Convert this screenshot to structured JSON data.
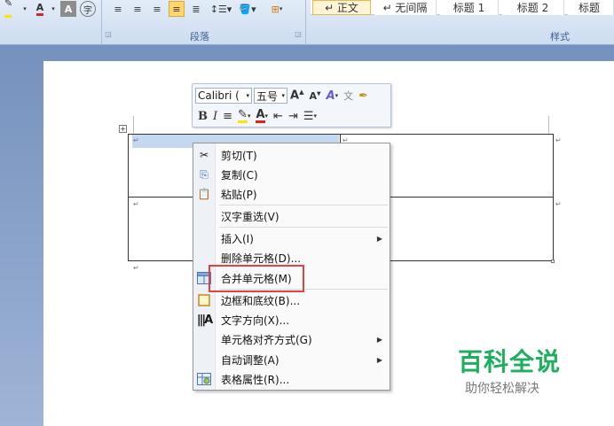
{
  "ribbon": {
    "paragraph_group_label": "段落",
    "styles_group_label": "样式",
    "styles": [
      "↵ 正文",
      "↵ 无间隔",
      "标题 1",
      "标题 2",
      "标题"
    ]
  },
  "mini_toolbar": {
    "font_name": "Calibri (",
    "font_size": "五号",
    "bold": "B",
    "italic": "I"
  },
  "context_menu": {
    "items": [
      {
        "label": "剪切(T)",
        "icon": "scissors-icon"
      },
      {
        "label": "复制(C)",
        "icon": "copy-icon"
      },
      {
        "label": "粘贴(P)",
        "icon": "paste-icon"
      },
      {
        "label": "汉字重选(V)",
        "icon": ""
      },
      {
        "label": "插入(I)",
        "icon": "",
        "submenu": true
      },
      {
        "label": "删除单元格(D)...",
        "icon": ""
      },
      {
        "label": "合并单元格(M)",
        "icon": "merge-cells-icon"
      },
      {
        "label": "边框和底纹(B)...",
        "icon": "borders-icon"
      },
      {
        "label": "文字方向(X)...",
        "icon": "text-direction-icon"
      },
      {
        "label": "单元格对齐方式(G)",
        "icon": "",
        "submenu": true
      },
      {
        "label": "自动调整(A)",
        "icon": "",
        "submenu": true
      },
      {
        "label": "表格属性(R)...",
        "icon": "table-properties-icon"
      }
    ]
  },
  "watermark": {
    "title": "百科全说",
    "subtitle": "助你轻松解决"
  },
  "colors": {
    "highlight_border": "#e2433f",
    "watermark_green": "#1fae5e",
    "selection": "#c4d8f2"
  }
}
